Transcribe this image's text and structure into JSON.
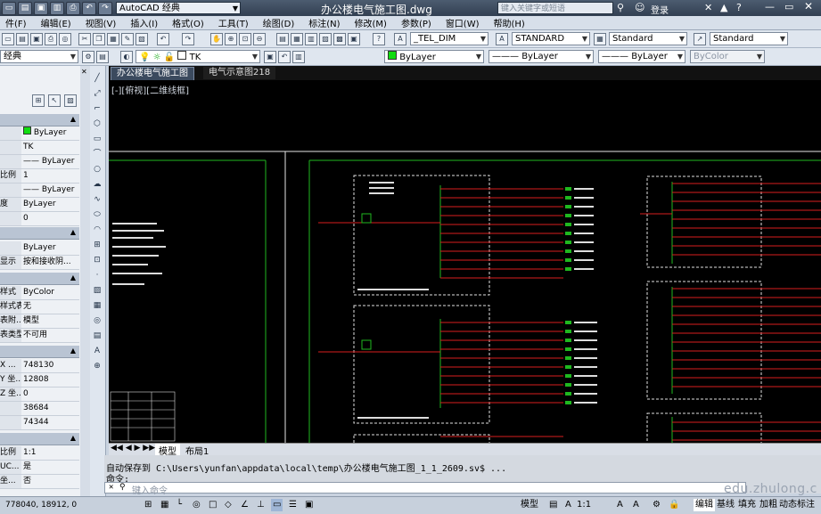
{
  "app": {
    "workspace": "AutoCAD 经典",
    "doc_title": "办公楼电气施工图.dwg",
    "search_placeholder": "键入关键字或短语",
    "login": "登录"
  },
  "menu": [
    "件(F)",
    "编辑(E)",
    "视图(V)",
    "插入(I)",
    "格式(O)",
    "工具(T)",
    "绘图(D)",
    "标注(N)",
    "修改(M)",
    "参数(P)",
    "窗口(W)",
    "帮助(H)"
  ],
  "toolbar": {
    "dim_style": "_TEL_DIM",
    "text_style": "STANDARD",
    "table_style": "Standard",
    "multileader_style": "Standard",
    "workspace_left": "经典",
    "layer": "TK",
    "color": "ByLayer",
    "linetype": "ByLayer",
    "lineweight": "ByLayer",
    "plotstyle": "ByColor"
  },
  "properties": {
    "rows": [
      {
        "k": "",
        "v": "ByLayer"
      },
      {
        "k": "",
        "v": "TK"
      },
      {
        "k": "",
        "v": "—— ByLayer"
      },
      {
        "k": "比例",
        "v": "1"
      },
      {
        "k": "",
        "v": "—— ByLayer"
      },
      {
        "k": "度",
        "v": "ByLayer"
      },
      {
        "k": "",
        "v": "0"
      },
      {
        "k": "",
        "v": "ByLayer"
      },
      {
        "k": "显示",
        "v": "按和接收阴..."
      },
      {
        "k": "样式",
        "v": "ByColor"
      },
      {
        "k": "样式表",
        "v": "无"
      },
      {
        "k": "表附...",
        "v": "模型"
      },
      {
        "k": "表类型",
        "v": "不可用"
      },
      {
        "k": "X ...",
        "v": "748130"
      },
      {
        "k": "Y 坐...",
        "v": "12808"
      },
      {
        "k": "Z 坐...",
        "v": "0"
      },
      {
        "k": "",
        "v": "38684"
      },
      {
        "k": "",
        "v": "74344"
      },
      {
        "k": "比例",
        "v": "1:1"
      },
      {
        "k": "UC...",
        "v": "是"
      },
      {
        "k": "坐...",
        "v": "否"
      }
    ]
  },
  "tabs": {
    "doc": [
      "办公楼电气施工图",
      "电气示意图218"
    ],
    "viewport_label": "[-][俯视][二维线框]",
    "layout": [
      "模型",
      "布局1"
    ]
  },
  "command": {
    "history": "自动保存到 C:\\Users\\yunfan\\appdata\\local\\temp\\办公楼电气施工图_1_1_2609.sv$ ...",
    "prompt": "命令:",
    "input_placeholder": "键入命令"
  },
  "status": {
    "coords": "778040, 18912, 0",
    "model": "模型",
    "scale": "1:1",
    "buttons": [
      "编辑",
      "基线",
      "填充",
      "加粗",
      "动态标注"
    ]
  },
  "watermark": "edu.zhulong.c"
}
